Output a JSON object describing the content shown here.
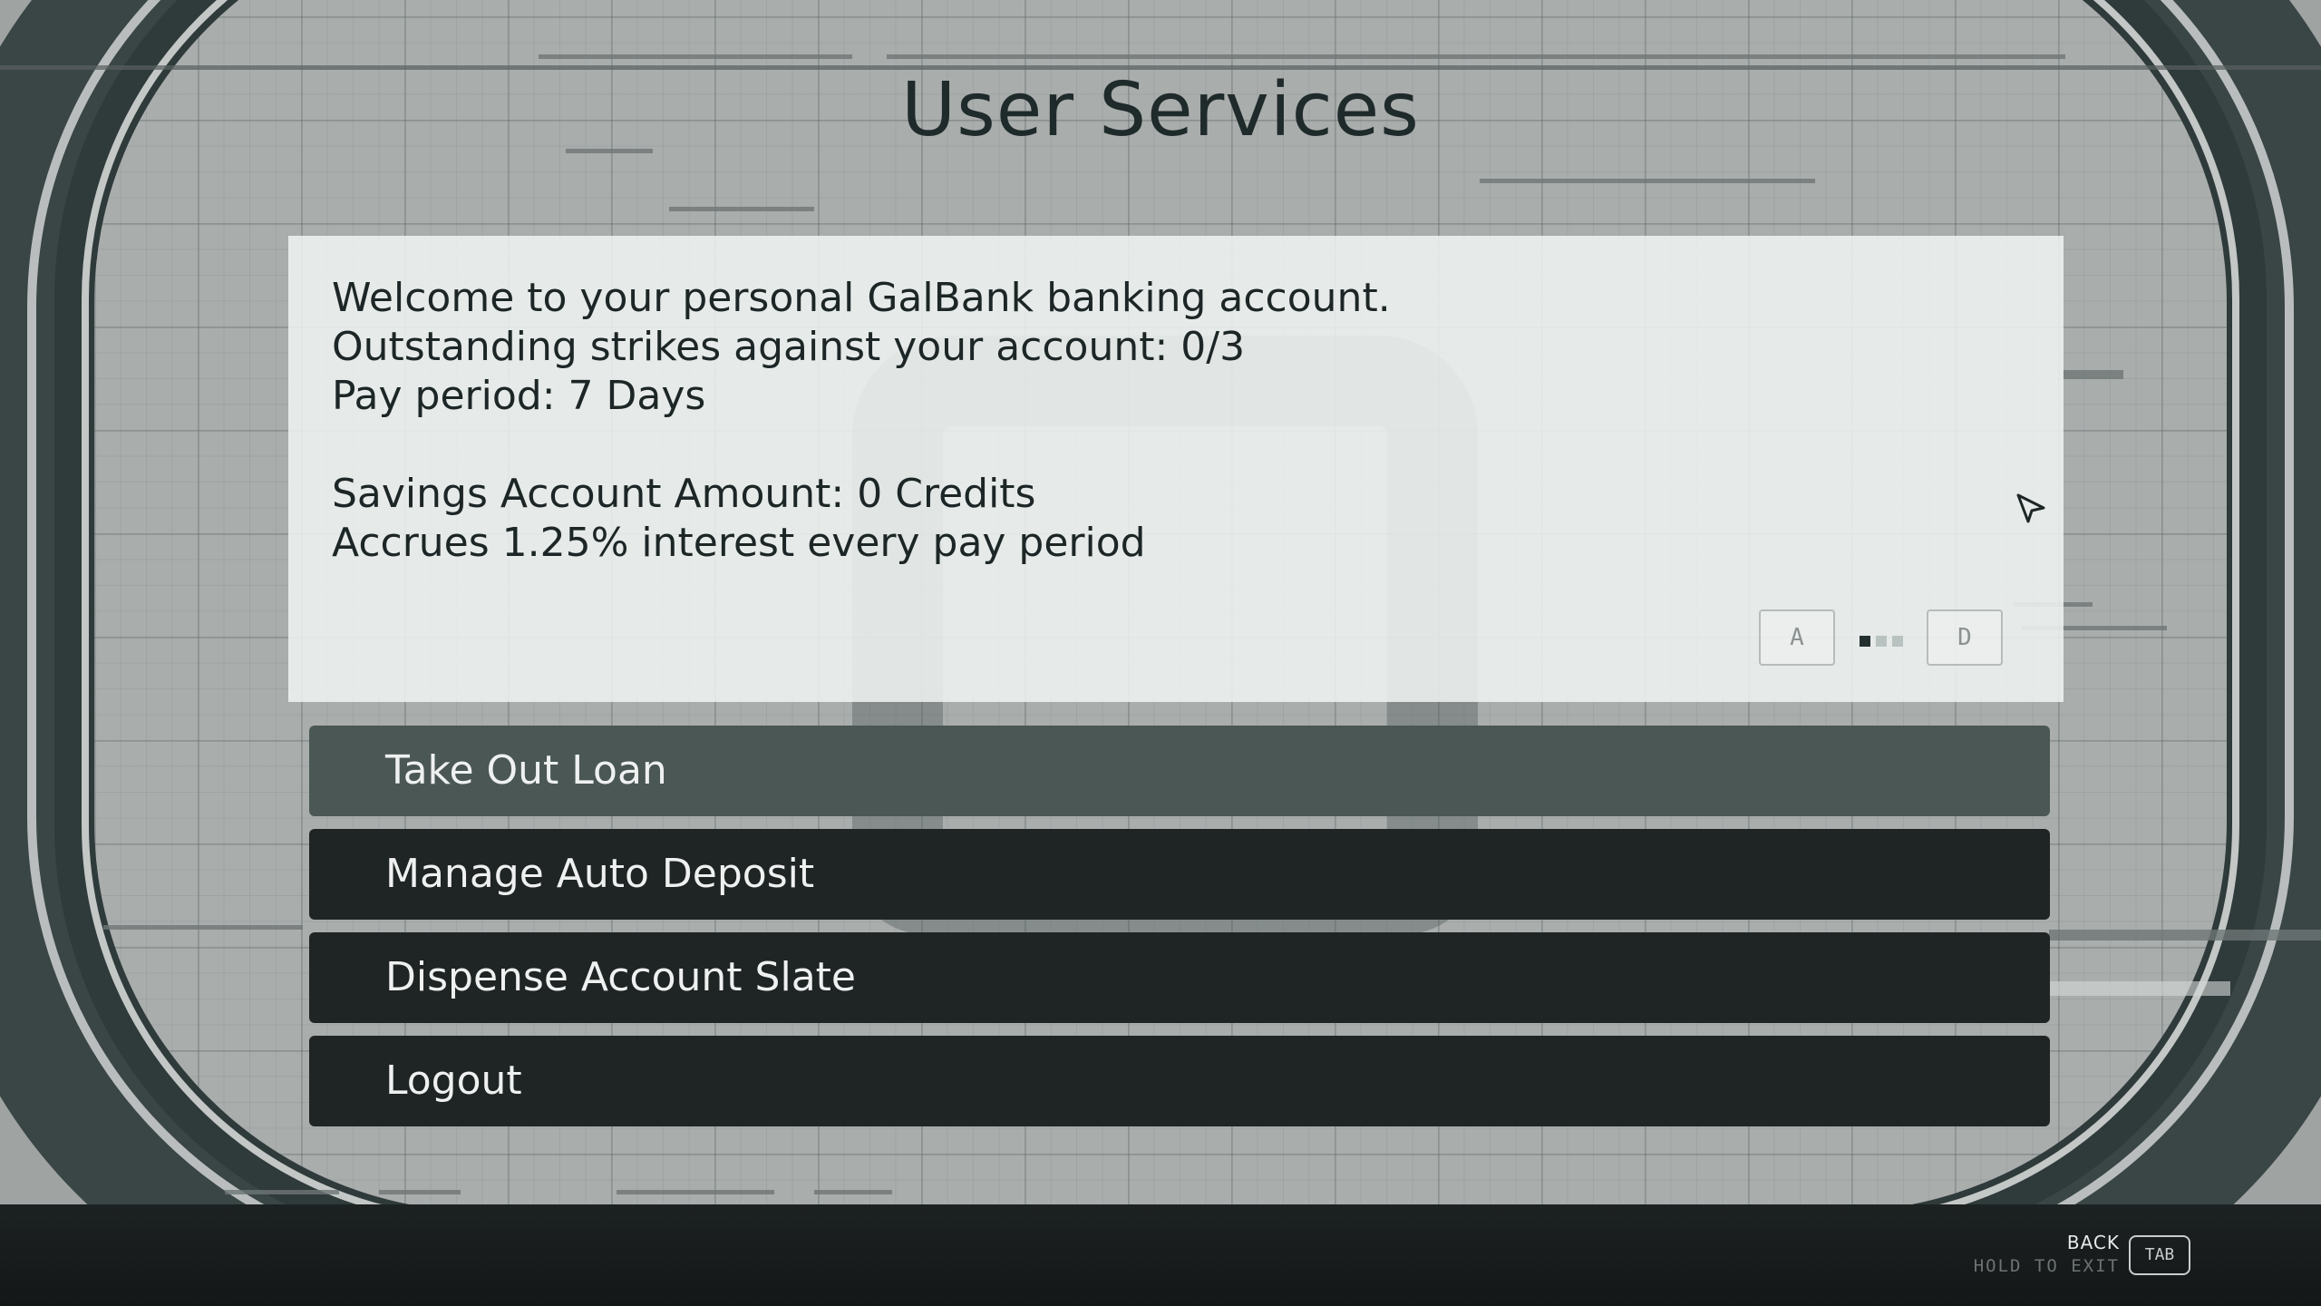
{
  "title": "User Services",
  "info": {
    "lines": [
      "Welcome to your personal GalBank banking account.",
      "Outstanding strikes against your account: 0/3",
      "Pay period: 7 Days"
    ],
    "savings_lines": [
      "Savings Account Amount: 0 Credits",
      "Accrues 1.25% interest every pay period"
    ],
    "pager": {
      "prev_key": "A",
      "next_key": "D",
      "pages": 3,
      "current_page": 1
    }
  },
  "menu": {
    "items": [
      {
        "label": "Take Out Loan",
        "selected": true
      },
      {
        "label": "Manage Auto Deposit",
        "selected": false
      },
      {
        "label": "Dispense Account Slate",
        "selected": false
      },
      {
        "label": "Logout",
        "selected": false
      }
    ]
  },
  "footer": {
    "back_label": "BACK",
    "hold_label": "HOLD TO EXIT",
    "key_label": "TAB"
  },
  "colors": {
    "selected_button": "#4a5755",
    "button": "#1f2524",
    "panel": "#eef2f0",
    "title": "#1f2a2a"
  }
}
